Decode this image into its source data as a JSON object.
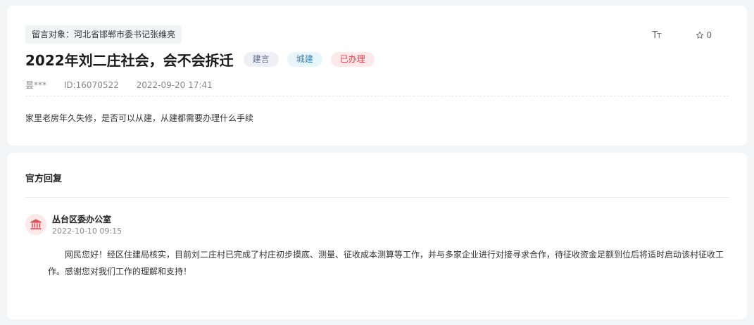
{
  "message": {
    "recipient": "留言对象：河北省邯郸市委书记张维亮",
    "title": "2022年刘二庄社会，会不会拆迁",
    "tags": {
      "type": "建言",
      "category": "城建",
      "status": "已办理"
    },
    "author": "昙***",
    "id": "ID:16070522",
    "datetime": "2022-09-20 17:41",
    "content": "家里老房年久失修，是否可以从建，从建都需要办理什么手续",
    "font_size_icon": "font-size-icon",
    "like_count": "0",
    "star_icon": "star-icon"
  },
  "reply": {
    "heading": "官方回复",
    "department": "丛台区委办公室",
    "datetime": "2022-10-10 09:15",
    "text": "网民您好！经区住建局核实，目前刘二庄村已完成了村庄初步摸底、测量、征收成本测算等工作，并与多家企业进行对接寻求合作，待征收资金足额到位后将适时启动该村征收工作。感谢您对我们工作的理解和支持！",
    "avatar_icon": "government-building-icon"
  },
  "colors": {
    "status_red": "#d9434e",
    "category_blue": "#3a7fb0",
    "type_gray": "#5d6b8c"
  }
}
